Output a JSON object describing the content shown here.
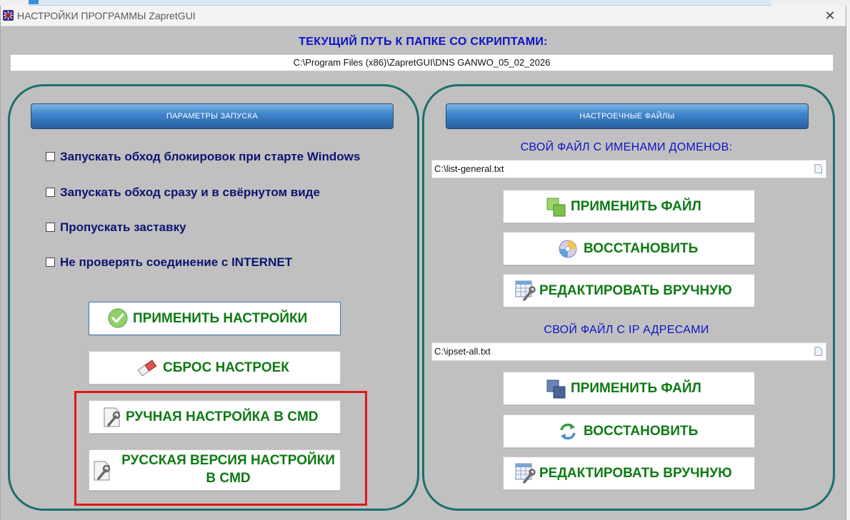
{
  "window": {
    "title": "НАСТРОЙКИ ПРОГРАММЫ ZapretGUI"
  },
  "path": {
    "label": "ТЕКУЩИЙ ПУТЬ К ПАПКЕ СО СКРИПТАМИ:",
    "value": "C:\\Program Files (x86)\\ZapretGUI\\DNS GANWO_05_02_2026"
  },
  "launch": {
    "header": "ПАРАМЕТРЫ ЗАПУСКА",
    "options": [
      {
        "label": "Запускать обход блокировок при старте Windows",
        "checked": false
      },
      {
        "label": "Запускать обход сразу и в свёрнутом виде",
        "checked": false
      },
      {
        "label": "Пропускать заставку",
        "checked": false
      },
      {
        "label": "Не проверять соединение с INTERNET",
        "checked": false
      }
    ],
    "buttons": {
      "apply": "ПРИМЕНИТЬ НАСТРОЙКИ",
      "reset": "СБРОС НАСТРОЕК",
      "manual_cmd": "РУЧНАЯ НАСТРОЙКА В CMD",
      "russian_cmd_line1": "РУССКАЯ ВЕРСИЯ НАСТРОЙКИ",
      "russian_cmd_line2": "В CMD"
    }
  },
  "files": {
    "header": "НАСТРОЕЧНЫЕ ФАЙЛЫ",
    "domains": {
      "label": "СВОЙ ФАЙЛ С ИМЕНАМИ ДОМЕНОВ:",
      "path": "C:\\list-general.txt",
      "apply": "ПРИМЕНИТЬ ФАЙЛ",
      "restore": "ВОССТАНОВИТЬ",
      "edit": "РЕДАКТИРОВАТЬ ВРУЧНУЮ"
    },
    "ips": {
      "label": "СВОЙ ФАЙЛ С IP АДРЕСАМИ",
      "path": "C:\\ipset-all.txt",
      "apply": "ПРИМЕНИТЬ ФАЙЛ",
      "restore": "ВОССТАНОВИТЬ",
      "edit": "РЕДАКТИРОВАТЬ ВРУЧНУЮ"
    }
  },
  "colors": {
    "accent_blue": "#0a14c8",
    "button_text_green": "#0e7a14",
    "option_text_navy": "#0c1470",
    "panel_border_teal": "#1e6e6e",
    "highlight_red": "#e01818"
  }
}
